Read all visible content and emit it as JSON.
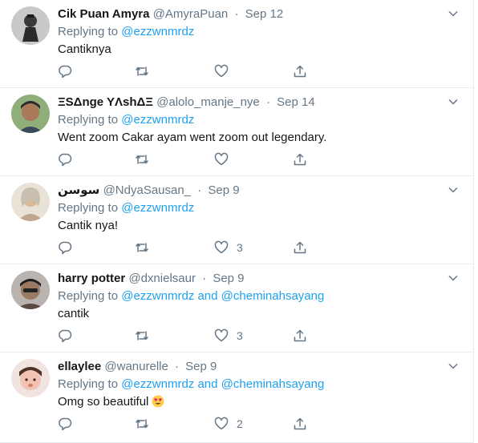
{
  "tweets": [
    {
      "name": "Cik Puan Amyra",
      "handle": "@AmyraPuan",
      "date": "Sep 12",
      "replying_prefix": "Replying to ",
      "mentions": [
        "@ezzwnmrdz"
      ],
      "text": "Cantiknya",
      "likes": ""
    },
    {
      "name": "ΞSΔnge YΛshΔΞ",
      "handle": "@alolo_manje_nye",
      "date": "Sep 14",
      "replying_prefix": "Replying to ",
      "mentions": [
        "@ezzwnmrdz"
      ],
      "text": "Went zoom Cakar ayam went zoom out legendary.",
      "likes": ""
    },
    {
      "name": "سوسن",
      "handle": "@NdyaSausan_",
      "date": "Sep 9",
      "replying_prefix": "Replying to ",
      "mentions": [
        "@ezzwnmrdz"
      ],
      "text": "Cantik nya!",
      "likes": "3"
    },
    {
      "name": "harry potter",
      "handle": "@dxnielsaur",
      "date": "Sep 9",
      "replying_prefix": "Replying to ",
      "mentions": [
        "@ezzwnmrdz",
        "@cheminahsayang"
      ],
      "joiner": " and ",
      "text": "cantik",
      "likes": "3"
    },
    {
      "name": "ellaylee",
      "handle": "@wanurelle",
      "date": "Sep 9",
      "replying_prefix": "Replying to ",
      "mentions": [
        "@ezzwnmrdz",
        "@cheminahsayang"
      ],
      "joiner": " and ",
      "text": "Omg so beautiful",
      "likes": "2"
    }
  ],
  "separator": "·",
  "colors": {
    "link": "#1da1f2",
    "muted": "#657786",
    "text": "#14171a",
    "border": "#e6ecf0"
  }
}
